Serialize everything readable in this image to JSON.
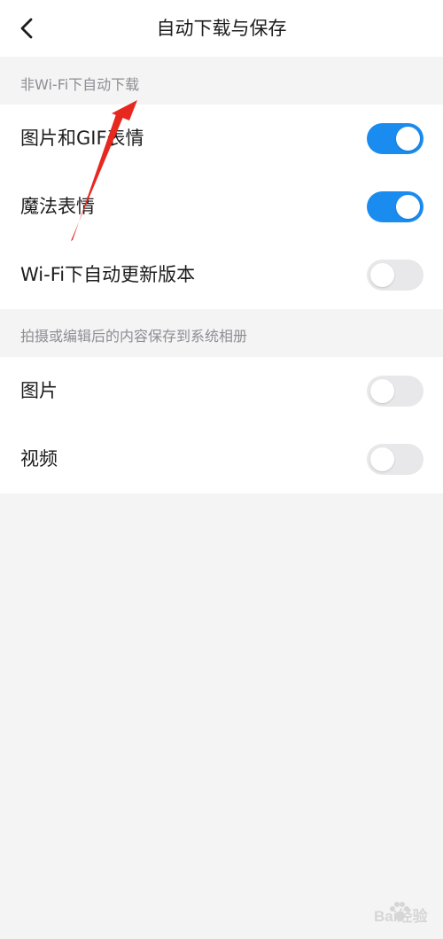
{
  "header": {
    "title": "自动下载与保存",
    "back_icon": "chevron-left-icon"
  },
  "sections": [
    {
      "title": "非Wi-Fi下自动下载",
      "items": [
        {
          "label": "图片和GIF表情",
          "on": true
        },
        {
          "label": "魔法表情",
          "on": true
        },
        {
          "label": "Wi-Fi下自动更新版本",
          "on": false
        }
      ]
    },
    {
      "title": "拍摄或编辑后的内容保存到系统相册",
      "items": [
        {
          "label": "图片",
          "on": false
        },
        {
          "label": "视频",
          "on": false
        }
      ]
    }
  ],
  "colors": {
    "switch_on": "#1a8cf0",
    "switch_off": "#e8e8ea",
    "annotation_arrow": "#e8271f"
  },
  "watermark": {
    "text": "Bai经验",
    "icon": "paw-logo-icon"
  }
}
